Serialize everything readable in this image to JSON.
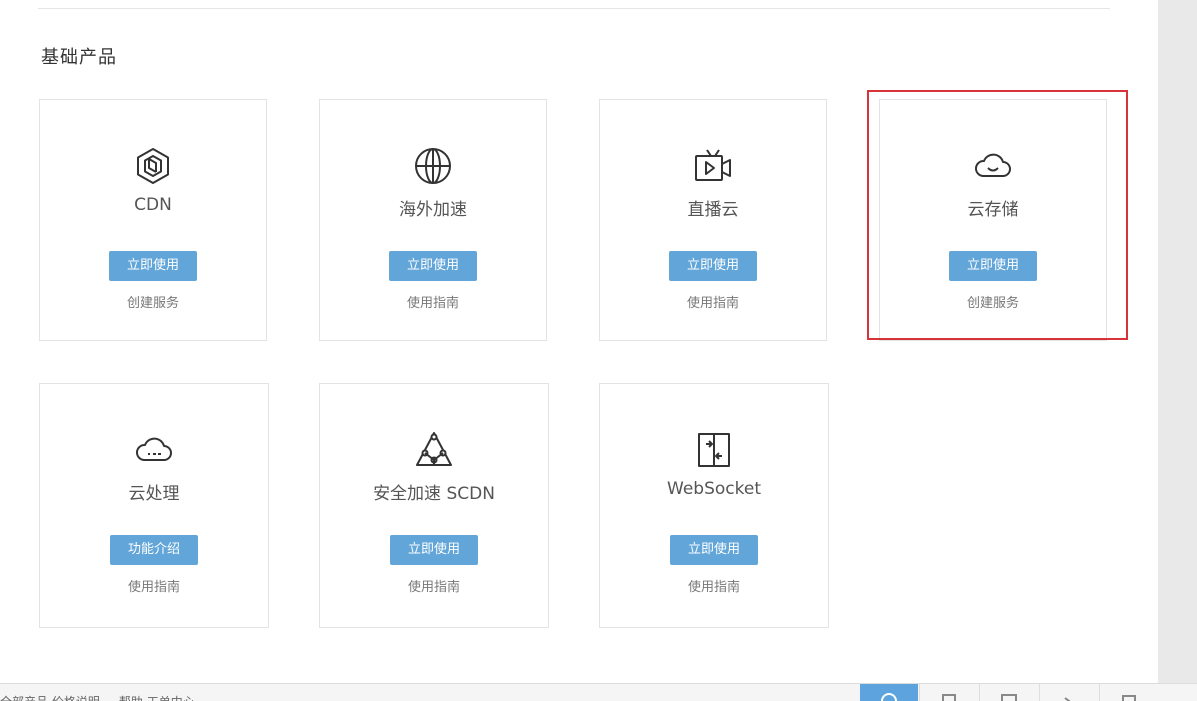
{
  "section": {
    "title": "基础产品"
  },
  "cards": [
    {
      "name": "CDN",
      "icon": "cdn-hexagon-icon",
      "button": "立即使用",
      "link": "创建服务"
    },
    {
      "name": "海外加速",
      "icon": "globe-icon",
      "button": "立即使用",
      "link": "使用指南"
    },
    {
      "name": "直播云",
      "icon": "tv-live-icon",
      "button": "立即使用",
      "link": "使用指南"
    },
    {
      "name": "云存储",
      "icon": "cloud-storage-icon",
      "button": "立即使用",
      "link": "创建服务"
    },
    {
      "name": "云处理",
      "icon": "cloud-processing-icon",
      "button": "功能介绍",
      "link": "使用指南"
    },
    {
      "name": "安全加速 SCDN",
      "icon": "secure-network-icon",
      "button": "立即使用",
      "link": "使用指南"
    },
    {
      "name": "WebSocket",
      "icon": "websocket-icon",
      "button": "立即使用",
      "link": "使用指南"
    }
  ],
  "bottom_bar": {
    "crumbs": "全部产品   价格说明   ...   帮助   工单中心",
    "tools": [
      "help-icon",
      "doc-icon",
      "panel-icon",
      "arrow-icon",
      "service-icon"
    ]
  },
  "colors": {
    "button": "#62a5d8",
    "highlight": "#d9333a",
    "bottom_active": "#5da4df"
  }
}
